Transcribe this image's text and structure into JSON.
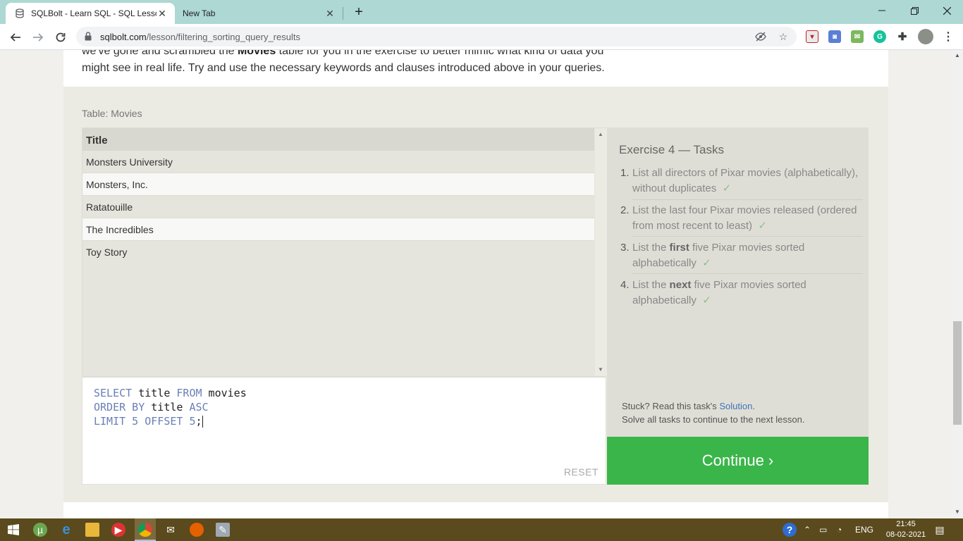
{
  "browser": {
    "tabs": [
      {
        "title": "SQLBolt - Learn SQL - SQL Lesso",
        "active": true
      },
      {
        "title": "New Tab",
        "active": false
      }
    ],
    "url_host": "sqlbolt.com",
    "url_path": "/lesson/filtering_sorting_query_results"
  },
  "page": {
    "intro_line1_pre": "we've gone and scrambled the ",
    "intro_line1_bold": "Movies",
    "intro_line1_post": " table for you in the exercise to better mimic what kind of data you",
    "intro_line2": "might see in real life. Try and use the necessary keywords and clauses introduced above in your queries.",
    "table_label": "Table: Movies",
    "table": {
      "header": "Title",
      "rows": [
        "Monsters University",
        "Monsters, Inc.",
        "Ratatouille",
        "The Incredibles",
        "Toy Story"
      ]
    },
    "editor": {
      "l1_kw1": "SELECT",
      "l1_t1": " title ",
      "l1_kw2": "FROM",
      "l1_t2": " movies",
      "l2_kw1": "ORDER BY",
      "l2_t1": " title ",
      "l2_kw2": "ASC",
      "l3_kw1": "LIMIT",
      "l3_n1": " 5 ",
      "l3_kw2": "OFFSET",
      "l3_n2": " 5",
      "l3_t1": ";",
      "reset_label": "RESET"
    },
    "tasks": {
      "title": "Exercise 4 — Tasks",
      "items": [
        {
          "num": "1.",
          "pre": "List all directors of Pixar movies (alphabetically), without duplicates",
          "check": "✓"
        },
        {
          "num": "2.",
          "pre": "List the last four Pixar movies released (ordered from most recent to least)",
          "check": "✓"
        },
        {
          "num": "3.",
          "pre": "List the ",
          "bold": "first",
          "post": " five Pixar movies sorted alphabetically",
          "check": "✓"
        },
        {
          "num": "4.",
          "pre": "List the ",
          "bold": "next",
          "post": " five Pixar movies sorted alphabetically",
          "check": "✓"
        }
      ],
      "stuck_pre": "Stuck? Read this task's ",
      "stuck_link": "Solution",
      "stuck_post": ".",
      "stuck_line2": "Solve all tasks to continue to the next lesson."
    },
    "continue_label": "Continue ›"
  },
  "taskbar": {
    "lang": "ENG",
    "time": "21:45",
    "date": "08-02-2021"
  },
  "colors": {
    "accent_green": "#3ab54a",
    "link_blue": "#3f74b9",
    "keyword_blue": "#6a7fb5",
    "tabbar": "#add8d4"
  }
}
